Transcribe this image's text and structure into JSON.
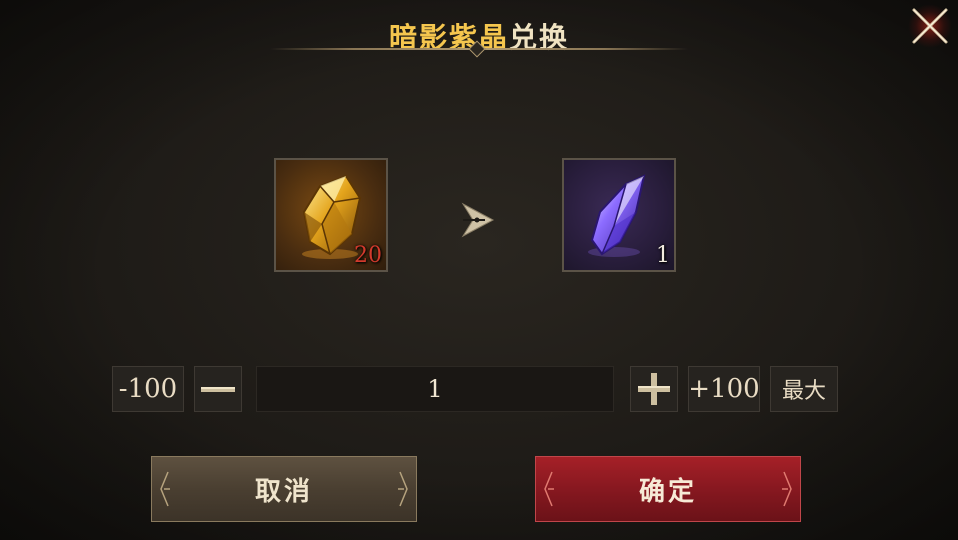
{
  "dialog": {
    "title_highlight": "暗影紫晶",
    "title_rest": "兑换"
  },
  "exchange": {
    "source_item": {
      "icon": "amber-crystal-icon",
      "count": "20",
      "count_color": "#d23a2c"
    },
    "target_item": {
      "icon": "violet-crystal-icon",
      "count": "1",
      "count_color": "#f2ece0"
    }
  },
  "quantity": {
    "minus_100_label": "-100",
    "plus_100_label": "+100",
    "max_label": "最大",
    "value": "1"
  },
  "actions": {
    "cancel_label": "取消",
    "confirm_label": "确定"
  },
  "colors": {
    "title_gold": "#f5c64e",
    "confirm_red": "#871820",
    "cancel_brown": "#4a3f31"
  }
}
